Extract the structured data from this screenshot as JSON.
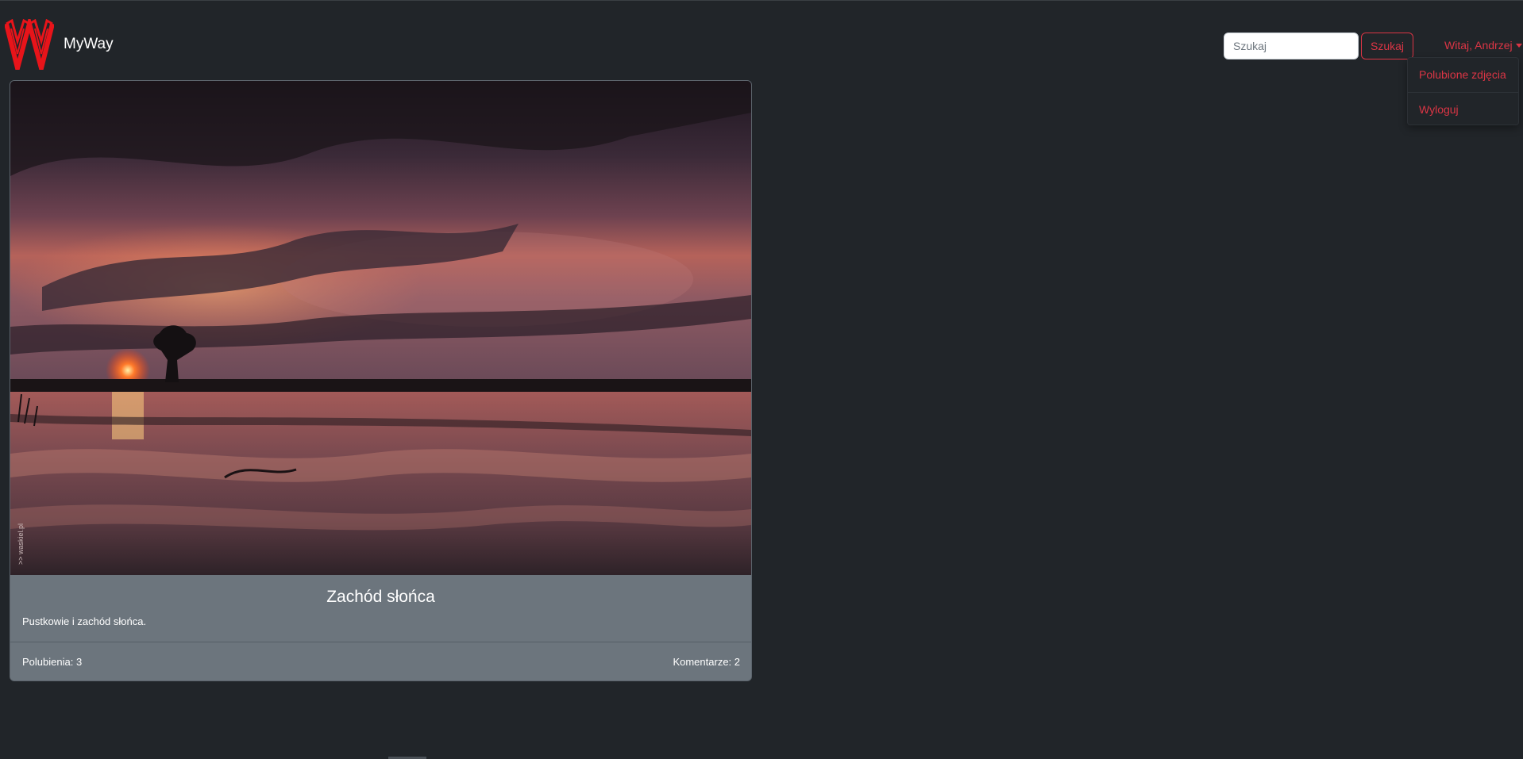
{
  "navbar": {
    "brand": "MyWay",
    "search": {
      "placeholder": "Szukaj",
      "value": "",
      "button_label": "Szukaj"
    },
    "user_menu": {
      "label": "Witaj, Andrzej",
      "items": [
        {
          "label": "Polubione zdjęcia"
        },
        {
          "label": "Wyloguj"
        }
      ]
    }
  },
  "post": {
    "image_watermark": ">> waskiel.pl",
    "title": "Zachód słońca",
    "description": "Pustkowie i zachód słońca.",
    "likes_label": "Polubienia: 3",
    "comments_label": "Komentarze: 2"
  },
  "colors": {
    "background": "#212529",
    "accent": "#dc3545",
    "card": "#6c757d",
    "logo": "#e8141a"
  }
}
